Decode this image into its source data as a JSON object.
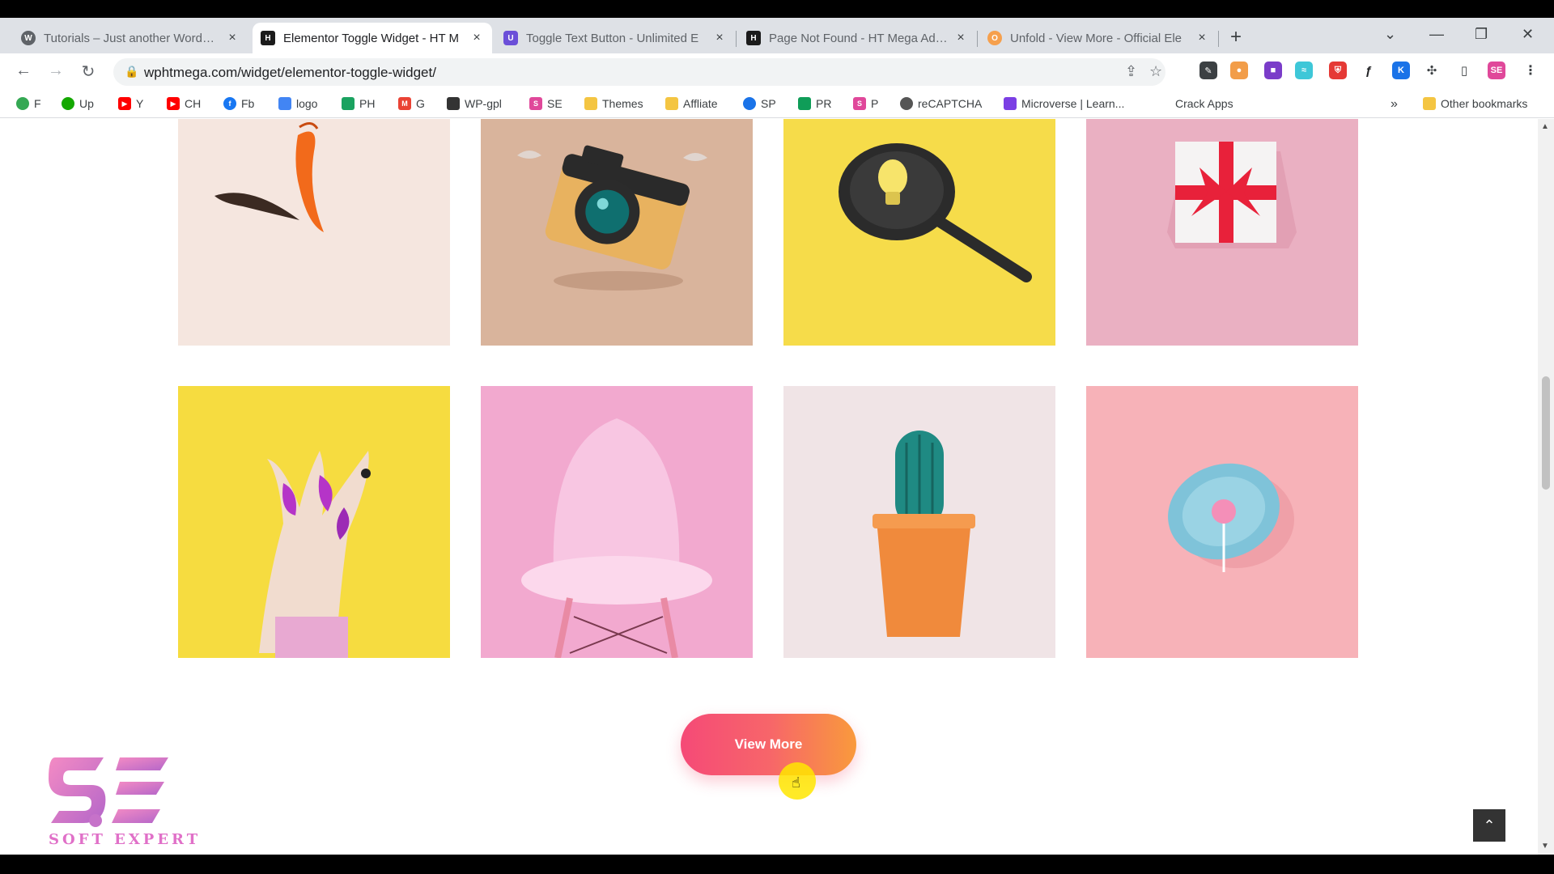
{
  "browser": {
    "tabs": [
      {
        "title": "Tutorials – Just another WordPre",
        "icon": "wordpress-icon",
        "active": false
      },
      {
        "title": "Elementor Toggle Widget - HT M",
        "icon": "htmega-icon",
        "active": true
      },
      {
        "title": "Toggle Text Button - Unlimited E",
        "icon": "unlimited-elements-icon",
        "active": false
      },
      {
        "title": "Page Not Found - HT Mega Addo",
        "icon": "htmega-icon",
        "active": false
      },
      {
        "title": "Unfold - View More - Official Ele",
        "icon": "unfold-icon",
        "active": false
      }
    ],
    "close_glyph": "×",
    "new_tab_glyph": "+",
    "url": "wphtmega.com/widget/elementor-toggle-widget/",
    "bookmarks": [
      {
        "label": "F",
        "color": "#34a853"
      },
      {
        "label": "Up",
        "color": "#14a800"
      },
      {
        "label": "Y",
        "color": "#ff0000"
      },
      {
        "label": "CH",
        "color": "#ff0000"
      },
      {
        "label": "Fb",
        "color": "#1877f2"
      },
      {
        "label": "logo",
        "color": "#4285f4"
      },
      {
        "label": "PH",
        "color": "#1aa260"
      },
      {
        "label": "G",
        "color": "#ea4335"
      },
      {
        "label": "WP-gpl",
        "color": "#333333"
      },
      {
        "label": "SE",
        "color": "#e0489a"
      },
      {
        "label": "Themes",
        "color": "#f4c542"
      },
      {
        "label": "Affliate",
        "color": "#f4c542"
      },
      {
        "label": "SP",
        "color": "#1a73e8"
      },
      {
        "label": "PR",
        "color": "#0f9d58"
      },
      {
        "label": "P",
        "color": "#e0489a"
      },
      {
        "label": "reCAPTCHA",
        "color": "#555555"
      },
      {
        "label": "Microverse | Learn...",
        "color": "#7b3fe4"
      },
      {
        "label": "Crack Apps",
        "color": "#ffffff"
      }
    ],
    "more_bookmarks_glyph": "»",
    "other_bookmarks": "Other bookmarks"
  },
  "page": {
    "gallery": [
      {
        "name": "gallery-image-shrimp-feather",
        "bg": "#f5e6df"
      },
      {
        "name": "gallery-image-camera",
        "bg": "#d9b49c"
      },
      {
        "name": "gallery-image-frying-pan-bulb",
        "bg": "#f6dc4a"
      },
      {
        "name": "gallery-image-gift-box",
        "bg": "#eab0c2"
      },
      {
        "name": "gallery-image-painted-hands",
        "bg": "#f6dc40"
      },
      {
        "name": "gallery-image-pink-chair",
        "bg": "#f2a9cf"
      },
      {
        "name": "gallery-image-cactus-pot",
        "bg": "#f0e4e6"
      },
      {
        "name": "gallery-image-lollipop-plate",
        "bg": "#f7b2b8"
      }
    ],
    "view_more_label": "View More",
    "back_to_top_glyph": "⌃",
    "logo_mark": "SE",
    "logo_caption": "SOFT EXPERT"
  }
}
